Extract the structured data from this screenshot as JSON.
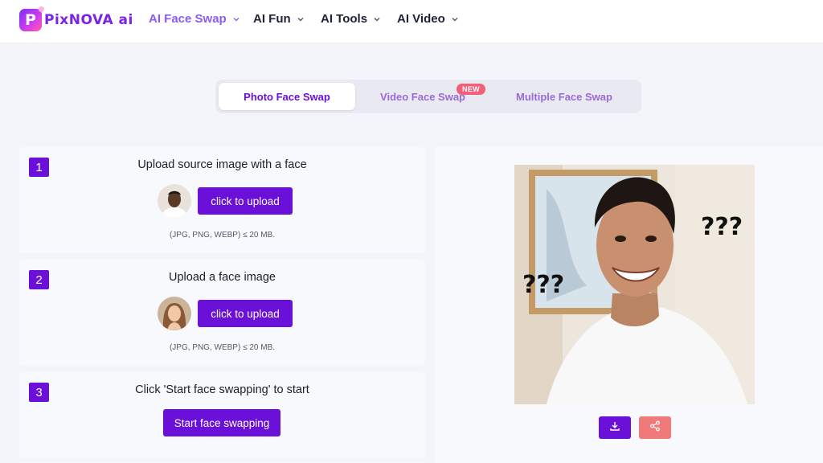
{
  "brand": {
    "logo_letter": "P",
    "name": "PixNOVA ai"
  },
  "nav": [
    {
      "label": "AI Face Swap",
      "active": true
    },
    {
      "label": "AI Fun",
      "active": false
    },
    {
      "label": "AI Tools",
      "active": false
    },
    {
      "label": "AI Video",
      "active": false
    }
  ],
  "tabs": [
    {
      "label": "Photo Face Swap",
      "selected": true
    },
    {
      "label": "Video Face Swap",
      "selected": false,
      "badge": "NEW"
    },
    {
      "label": "Multiple Face Swap",
      "selected": false
    }
  ],
  "steps": [
    {
      "number": "1",
      "title": "Upload source image with a face",
      "button": "click to upload",
      "hint": "(JPG, PNG, WEBP) ≤ 20 MB."
    },
    {
      "number": "2",
      "title": "Upload a face image",
      "button": "click to upload",
      "hint": "(JPG, PNG, WEBP) ≤ 20 MB."
    },
    {
      "number": "3",
      "title": "Click 'Start face swapping' to start",
      "button": "Start face swapping"
    }
  ],
  "preview": {
    "left_caption": "???",
    "right_caption": "???"
  },
  "actions": {
    "download_icon": "download-icon",
    "share_icon": "share-icon"
  },
  "colors": {
    "primary": "#6a10d8",
    "accent_light": "#8a5cf6",
    "share": "#f07a7a",
    "badge": "#f0607a"
  }
}
